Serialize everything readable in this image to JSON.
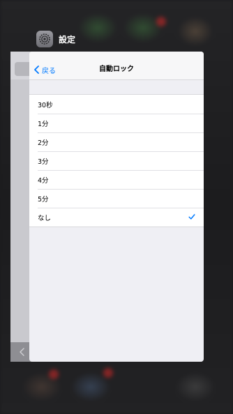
{
  "app": {
    "title": "設定",
    "icon": "gear-icon"
  },
  "navbar": {
    "back_label": "戻る",
    "title": "自動ロック"
  },
  "auto_lock_options": [
    {
      "label": "30秒",
      "selected": false
    },
    {
      "label": "1分",
      "selected": false
    },
    {
      "label": "2分",
      "selected": false
    },
    {
      "label": "3分",
      "selected": false
    },
    {
      "label": "4分",
      "selected": false
    },
    {
      "label": "5分",
      "selected": false
    },
    {
      "label": "なし",
      "selected": true
    }
  ],
  "colors": {
    "accent": "#007aff",
    "group_background": "#efeff4",
    "row_background": "#ffffff"
  }
}
